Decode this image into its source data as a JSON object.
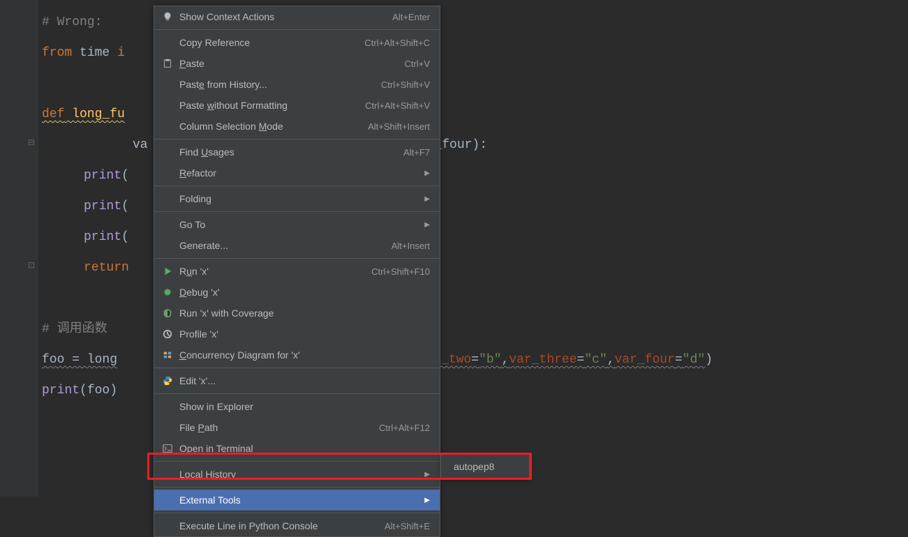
{
  "code": {
    "line1_comment": "# Wrong:",
    "line2_from": "from",
    "line2_mod": " time ",
    "line2_import": "i",
    "line3_def": "def",
    "line3_fn": " long_fu",
    "line4": "va",
    "line4_rest": "r_four):",
    "line5_print": "print",
    "line5_paren": "(",
    "line6_print": "print",
    "line6_paren": "(",
    "line7_print": "print",
    "line7_paren": "(",
    "line8_return": "return",
    "line9_comment": "# 调用函数",
    "line10_foo": "foo = long",
    "line10_comma": ",",
    "line10_p1": "var_two",
    "line10_eq": "=",
    "line10_s1": "\"b\"",
    "line10_p2": "var_three",
    "line10_s2": "\"c\"",
    "line10_p3": "var_four",
    "line10_s3": "\"d\"",
    "line10_end": ")",
    "line11_print": "print",
    "line11_rest": "(foo)"
  },
  "menu": {
    "items": [
      {
        "icon": "bulb",
        "label": "Show Context Actions",
        "shortcut": "Alt+Enter"
      },
      {
        "sep": true
      },
      {
        "label": "Copy Reference",
        "shortcut": "Ctrl+Alt+Shift+C"
      },
      {
        "icon": "paste",
        "label": "Paste",
        "u": "P",
        "shortcut": "Ctrl+V"
      },
      {
        "label": "Paste from History...",
        "u": "e",
        "shortcut": "Ctrl+Shift+V"
      },
      {
        "label": "Paste without Formatting",
        "u": "w",
        "shortcut": "Ctrl+Alt+Shift+V"
      },
      {
        "label": "Column Selection Mode",
        "u": "M",
        "shortcut": "Alt+Shift+Insert"
      },
      {
        "sep": true
      },
      {
        "label": "Find Usages",
        "u": "U",
        "shortcut": "Alt+F7"
      },
      {
        "label": "Refactor",
        "u": "R",
        "arrow": true
      },
      {
        "sep": true
      },
      {
        "label": "Folding",
        "arrow": true
      },
      {
        "sep": true
      },
      {
        "label": "Go To",
        "arrow": true
      },
      {
        "label": "Generate...",
        "shortcut": "Alt+Insert"
      },
      {
        "sep": true
      },
      {
        "icon": "run",
        "label": "Run 'x'",
        "u": "u",
        "shortcut": "Ctrl+Shift+F10"
      },
      {
        "icon": "debug",
        "label": "Debug 'x'",
        "u": "D"
      },
      {
        "icon": "coverage",
        "label": "Run 'x' with Coverage"
      },
      {
        "icon": "profile",
        "label": "Profile 'x'"
      },
      {
        "icon": "concurrency",
        "label": "Concurrency Diagram for 'x'",
        "u": "C"
      },
      {
        "sep": true
      },
      {
        "icon": "python",
        "label": "Edit 'x'..."
      },
      {
        "sep": true
      },
      {
        "label": "Show in Explorer"
      },
      {
        "label": "File Path",
        "u": "P",
        "shortcut": "Ctrl+Alt+F12"
      },
      {
        "icon": "terminal",
        "label": "Open in Terminal"
      },
      {
        "sep": true
      },
      {
        "label": "Local History",
        "u": "H",
        "arrow": true
      },
      {
        "sep": true
      },
      {
        "label": "External Tools",
        "arrow": true,
        "highlighted": true
      },
      {
        "sep": true
      },
      {
        "label": "Execute Line in Python Console",
        "shortcut": "Alt+Shift+E"
      }
    ]
  },
  "submenu": {
    "label": "autopep8"
  }
}
